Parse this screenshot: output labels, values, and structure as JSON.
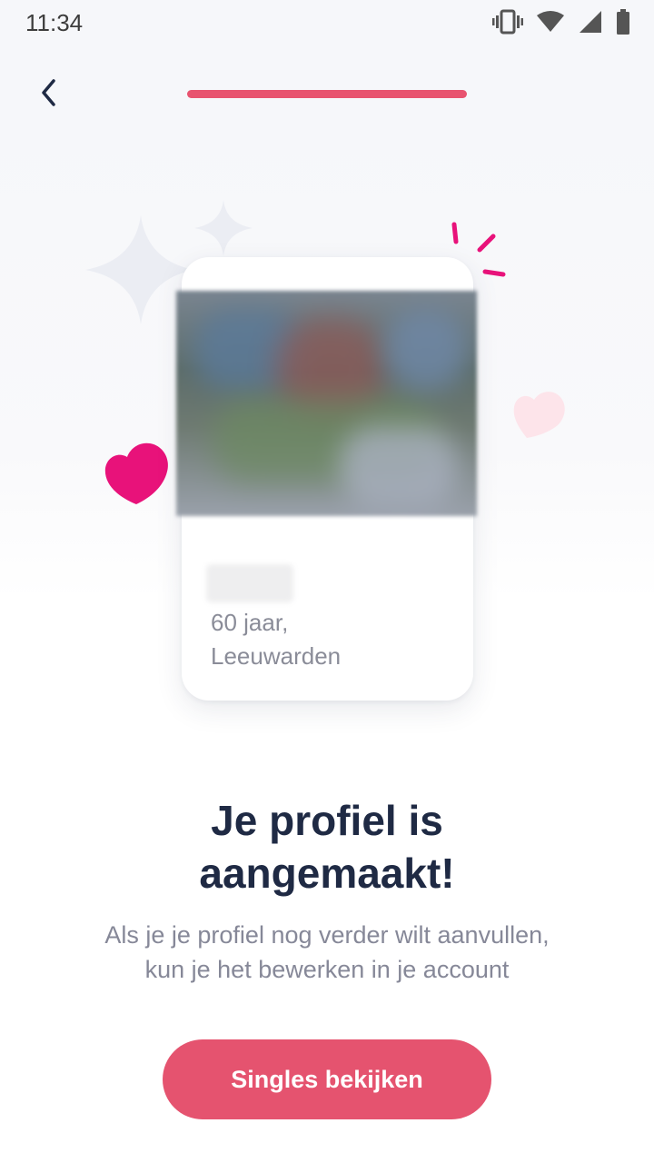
{
  "status_bar": {
    "time": "11:34",
    "icons": [
      "vibrate-icon",
      "wifi-icon",
      "signal-icon",
      "battery-icon"
    ]
  },
  "header": {
    "back_icon": "chevron-left-icon",
    "progress": 1.0
  },
  "decorations": [
    "sparkle-icon",
    "heart-icon",
    "spark-lines-icon"
  ],
  "profile_card": {
    "age_text": "60 jaar,",
    "city_text": "Leeuwarden"
  },
  "content": {
    "headline_line1": "Je profiel is",
    "headline_line2": "aangemaakt!",
    "subtext_line1": "Als je je profiel nog verder wilt aanvullen,",
    "subtext_line2": "kun je het bewerken in je account"
  },
  "cta": {
    "label": "Singles bekijken"
  },
  "colors": {
    "accent": "#e5536f",
    "heart_pink": "#e8127a",
    "heart_light": "#fde4ea",
    "title_dark": "#1f2a44",
    "muted_text": "#868898",
    "sparkle": "#ebedf3"
  }
}
